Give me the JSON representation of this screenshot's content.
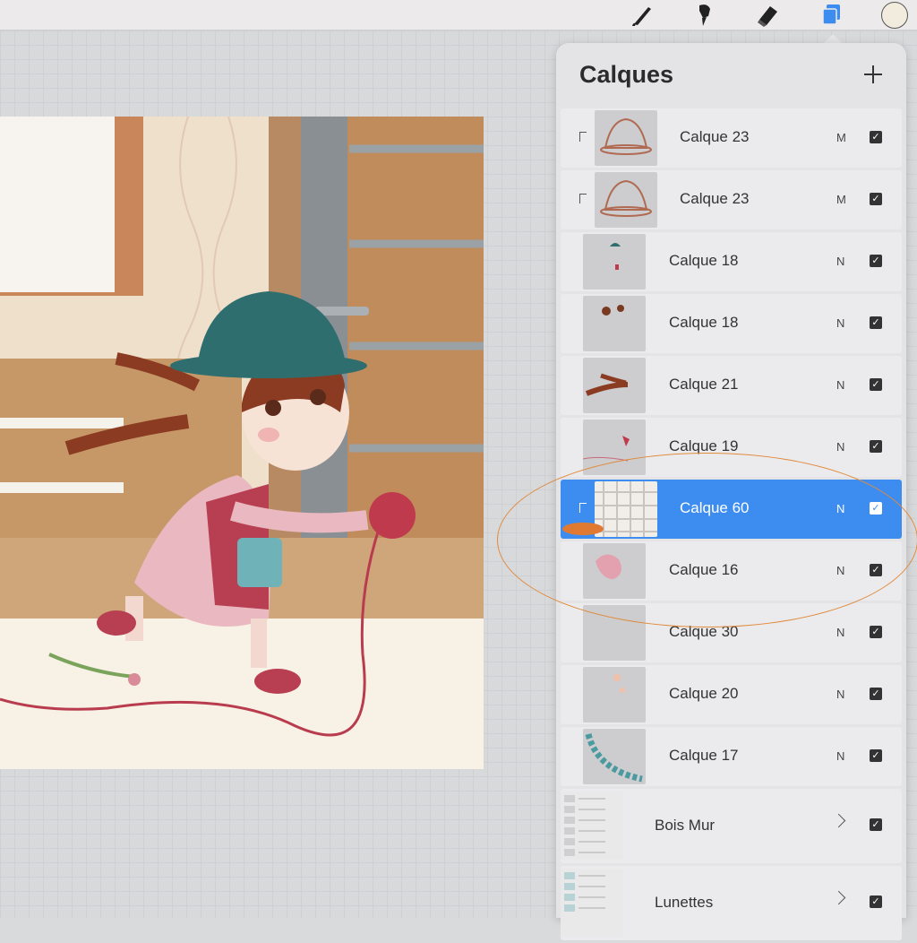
{
  "app": {
    "toolbar": {
      "tools": [
        {
          "icon": "brush-icon"
        },
        {
          "icon": "smudge-icon"
        },
        {
          "icon": "eraser-icon"
        },
        {
          "icon": "layers-icon",
          "active": true
        },
        {
          "icon": "color-swatch"
        }
      ],
      "active_color": "#3d8df0",
      "current_color_swatch": "#f1ecdd"
    },
    "layers_panel": {
      "title": "Calques",
      "add_icon": "plus-icon",
      "layers": [
        {
          "name": "Calque 23",
          "blend": "M",
          "visible": true,
          "clipped": true,
          "selected": false
        },
        {
          "name": "Calque 23",
          "blend": "M",
          "visible": true,
          "clipped": true,
          "selected": false
        },
        {
          "name": "Calque 18",
          "blend": "N",
          "visible": true,
          "clipped": false,
          "selected": false
        },
        {
          "name": "Calque 18",
          "blend": "N",
          "visible": true,
          "clipped": false,
          "selected": false
        },
        {
          "name": "Calque 21",
          "blend": "N",
          "visible": true,
          "clipped": false,
          "selected": false
        },
        {
          "name": "Calque 19",
          "blend": "N",
          "visible": true,
          "clipped": false,
          "selected": false
        },
        {
          "name": "Calque 60",
          "blend": "N",
          "visible": true,
          "clipped": true,
          "selected": true
        },
        {
          "name": "Calque 16",
          "blend": "N",
          "visible": true,
          "clipped": false,
          "selected": false
        },
        {
          "name": "Calque 30",
          "blend": "N",
          "visible": true,
          "clipped": false,
          "selected": false
        },
        {
          "name": "Calque 20",
          "blend": "N",
          "visible": true,
          "clipped": false,
          "selected": false
        },
        {
          "name": "Calque 17",
          "blend": "N",
          "visible": true,
          "clipped": false,
          "selected": false
        }
      ],
      "groups": [
        {
          "name": "Bois Mur",
          "visible": true
        },
        {
          "name": "Lunettes",
          "visible": true
        }
      ],
      "check_mark": "✓",
      "selected_color": "#3d8df0",
      "annotation_color": "#e08a3c"
    }
  }
}
